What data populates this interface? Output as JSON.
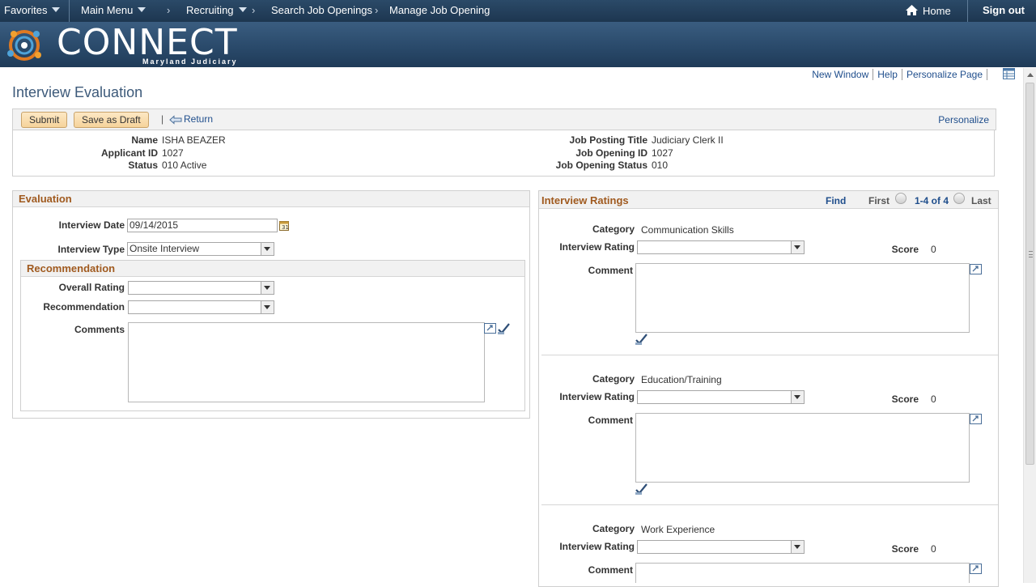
{
  "topnav": {
    "favorites": "Favorites",
    "main_menu": "Main Menu",
    "breadcrumbs": [
      "Recruiting",
      "Search Job Openings",
      "Manage Job Opening"
    ],
    "home": "Home",
    "sign_out": "Sign out"
  },
  "banner": {
    "logo_text": "CONNECT",
    "logo_sub": "Maryland Judiciary"
  },
  "header_links": [
    "New Window",
    "Help",
    "Personalize Page"
  ],
  "page_title": "Interview Evaluation",
  "toolbar": {
    "submit": "Submit",
    "save_draft": "Save as Draft",
    "separator": "|",
    "return": "Return",
    "personalize": "Personalize"
  },
  "applicant": {
    "name_label": "Name",
    "name": "ISHA BEAZER",
    "id_label": "Applicant ID",
    "id": "1027",
    "status_label": "Status",
    "status": "010 Active",
    "job_title_label": "Job Posting Title",
    "job_title": "Judiciary Clerk II",
    "job_id_label": "Job Opening ID",
    "job_id": "1027",
    "job_status_label": "Job Opening Status",
    "job_status": "010"
  },
  "evaluation": {
    "title": "Evaluation",
    "date_label": "Interview Date",
    "date_value": "09/14/2015",
    "type_label": "Interview Type",
    "type_value": "Onsite Interview",
    "recommendation_title": "Recommendation",
    "overall_rating_label": "Overall Rating",
    "overall_rating_value": "",
    "recommendation_label": "Recommendation",
    "recommendation_value": "",
    "comments_label": "Comments"
  },
  "ratings": {
    "title": "Interview Ratings",
    "find": "Find",
    "first": "First",
    "range": "1-4 of 4",
    "last": "Last",
    "category_label": "Category",
    "rating_label": "Interview Rating",
    "score_label": "Score",
    "comment_label": "Comment",
    "items": [
      {
        "category": "Communication Skills",
        "score": "0",
        "rating": ""
      },
      {
        "category": "Education/Training",
        "score": "0",
        "rating": ""
      },
      {
        "category": "Work Experience",
        "score": "0",
        "rating": ""
      }
    ]
  },
  "colors": {
    "nav_bg": "#1d3650",
    "section_title": "#a05a1f",
    "link": "#1f4e8c",
    "button": "#f6d39b"
  }
}
